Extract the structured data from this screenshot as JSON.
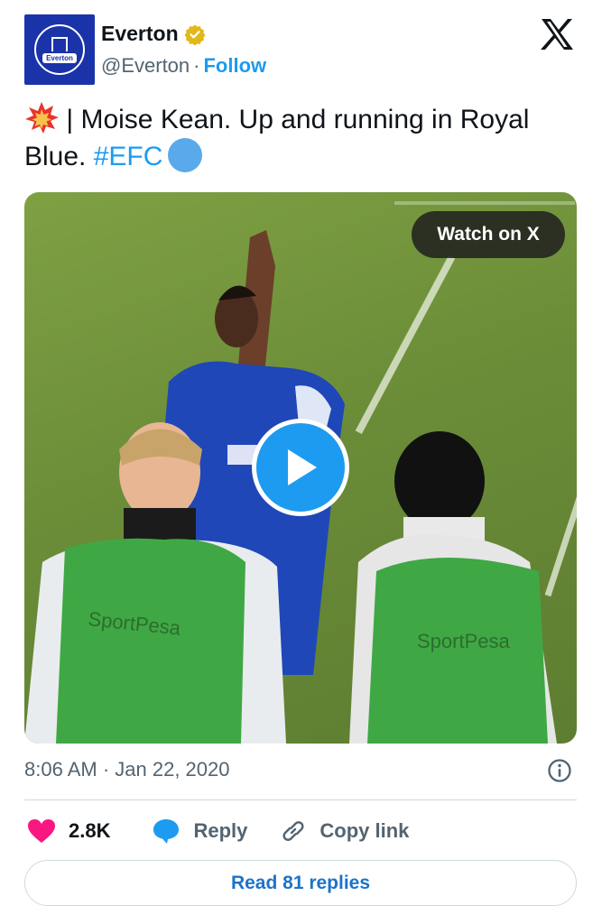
{
  "author": {
    "display_name": "Everton",
    "handle": "@Everton",
    "separator": "·",
    "follow_label": "Follow",
    "avatar_icon": "everton-crest-icon",
    "verified_icon": "gold-verified-badge-icon",
    "brand_color": "#1b33a8"
  },
  "platform_icon": "x-logo-icon",
  "tweet": {
    "emoji_icon": "collision-emoji-icon",
    "text_before": " | Moise Kean. Up and running in Royal Blue. ",
    "hashtag": "#EFC",
    "trailing_emoji_icon": "blue-circle-emoji-icon",
    "hashtag_color": "#1d9bf0"
  },
  "media": {
    "watch_label": "Watch on X",
    "play_icon": "play-icon",
    "bib_text_left": "SportPesa",
    "bib_text_right": "SportPesa",
    "shirt_text": "SportP"
  },
  "meta": {
    "timestamp": "8:06 AM · Jan 22, 2020",
    "info_icon": "info-icon"
  },
  "actions": {
    "like_count": "2.8K",
    "like_color": "#f91880",
    "reply_label": "Reply",
    "copy_label": "Copy link"
  },
  "read_replies_label": "Read 81 replies"
}
